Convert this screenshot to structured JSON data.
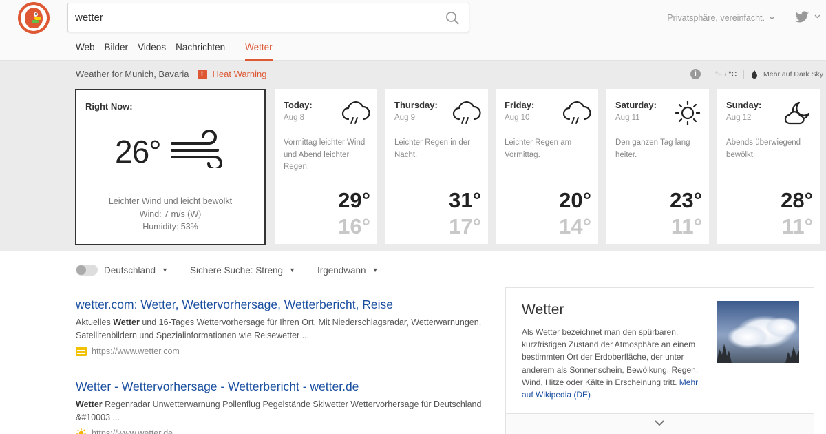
{
  "search": {
    "query": "wetter"
  },
  "header": {
    "privacy_label": "Privatsphäre, vereinfacht.",
    "brand_color": "#de5833"
  },
  "nav": {
    "items": [
      {
        "label": "Web"
      },
      {
        "label": "Bilder"
      },
      {
        "label": "Videos"
      },
      {
        "label": "Nachrichten"
      }
    ],
    "active": {
      "label": "Wetter"
    }
  },
  "weather": {
    "location": "Weather for Munich, Bavaria",
    "warning_icon": "!",
    "warning": "Heat Warning",
    "unit_f": "°F",
    "unit_sep": " / ",
    "unit_c": "°C",
    "dark_sky_link": "Mehr auf Dark Sky",
    "now": {
      "label": "Right Now:",
      "temp": "26°",
      "desc": "Leichter Wind und leicht bewölkt",
      "wind": "Wind: 7 m/s (W)",
      "humidity": "Humidity: 53%",
      "icon": "wind-icon"
    },
    "days": [
      {
        "name": "Today:",
        "date": "Aug 8",
        "desc": "Vormittag leichter Wind und Abend leichter Regen.",
        "high": "29°",
        "low": "16°",
        "icon": "rain-cloud-icon"
      },
      {
        "name": "Thursday:",
        "date": "Aug 9",
        "desc": "Leichter Regen in der Nacht.",
        "high": "31°",
        "low": "17°",
        "icon": "rain-cloud-icon"
      },
      {
        "name": "Friday:",
        "date": "Aug 10",
        "desc": "Leichter Regen am Vormittag.",
        "high": "20°",
        "low": "14°",
        "icon": "rain-cloud-icon"
      },
      {
        "name": "Saturday:",
        "date": "Aug 11",
        "desc": "Den ganzen Tag lang heiter.",
        "high": "23°",
        "low": "11°",
        "icon": "sun-icon"
      },
      {
        "name": "Sunday:",
        "date": "Aug 12",
        "desc": "Abends überwiegend bewölkt.",
        "high": "28°",
        "low": "11°",
        "icon": "moon-cloud-icon"
      }
    ]
  },
  "filters": {
    "region": "Deutschland",
    "safe_search": "Sichere Suche: Streng",
    "time": "Irgendwann"
  },
  "results": [
    {
      "title": "wetter.com: Wetter, Wettervorhersage, Wetterbericht, Reise",
      "snippet_bold": "Wetter",
      "snippet_pre": "Aktuelles ",
      "snippet_post": " und 16-Tages Wettervorhersage für Ihren Ort. Mit Niederschlagsradar, Wetterwarnungen, Satellitenbildern und Spezialinformationen wie Reisewetter ...",
      "url": "https://www.wetter.com"
    },
    {
      "title": "Wetter - Wettervorhersage - Wetterbericht - wetter.de",
      "snippet_bold": "Wetter",
      "snippet_pre": "",
      "snippet_post": " Regenradar Unwetterwarnung Pollenflug Pegelstände Skiwetter Wettervorhersage für Deutschland &#10003 ...",
      "url": "https://www.wetter.de"
    }
  ],
  "side_panel": {
    "title": "Wetter",
    "desc": "Als Wetter bezeichnet man den spürbaren, kurzfristigen Zustand der Atmosphäre an einem bestimmten Ort der Erdoberfläche, der unter anderem als Sonnenschein, Bewölkung, Regen, Wind, Hitze oder Kälte in Erscheinung tritt.",
    "more_link": "Mehr auf Wikipedia (DE)"
  },
  "colors": {
    "accent": "#de5833",
    "link": "#1a4fa0",
    "band": "#ebebeb"
  }
}
